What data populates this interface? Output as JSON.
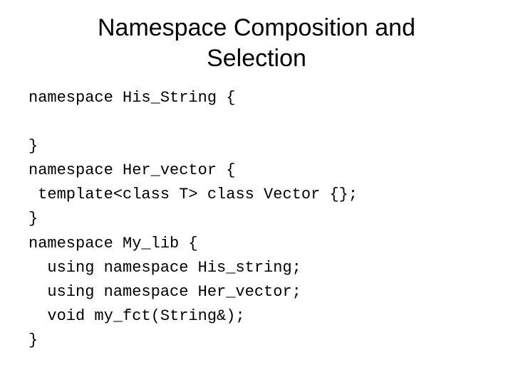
{
  "title": "Namespace Composition and Selection",
  "code": {
    "l1": "namespace His_String {",
    "l2": "",
    "l3": "}",
    "l4": "namespace Her_vector {",
    "l5": " template<class T> class Vector {};",
    "l6": "}",
    "l7": "namespace My_lib {",
    "l8": "  using namespace His_string;",
    "l9": "  using namespace Her_vector;",
    "l10": "  void my_fct(String&);",
    "l11": "}"
  }
}
